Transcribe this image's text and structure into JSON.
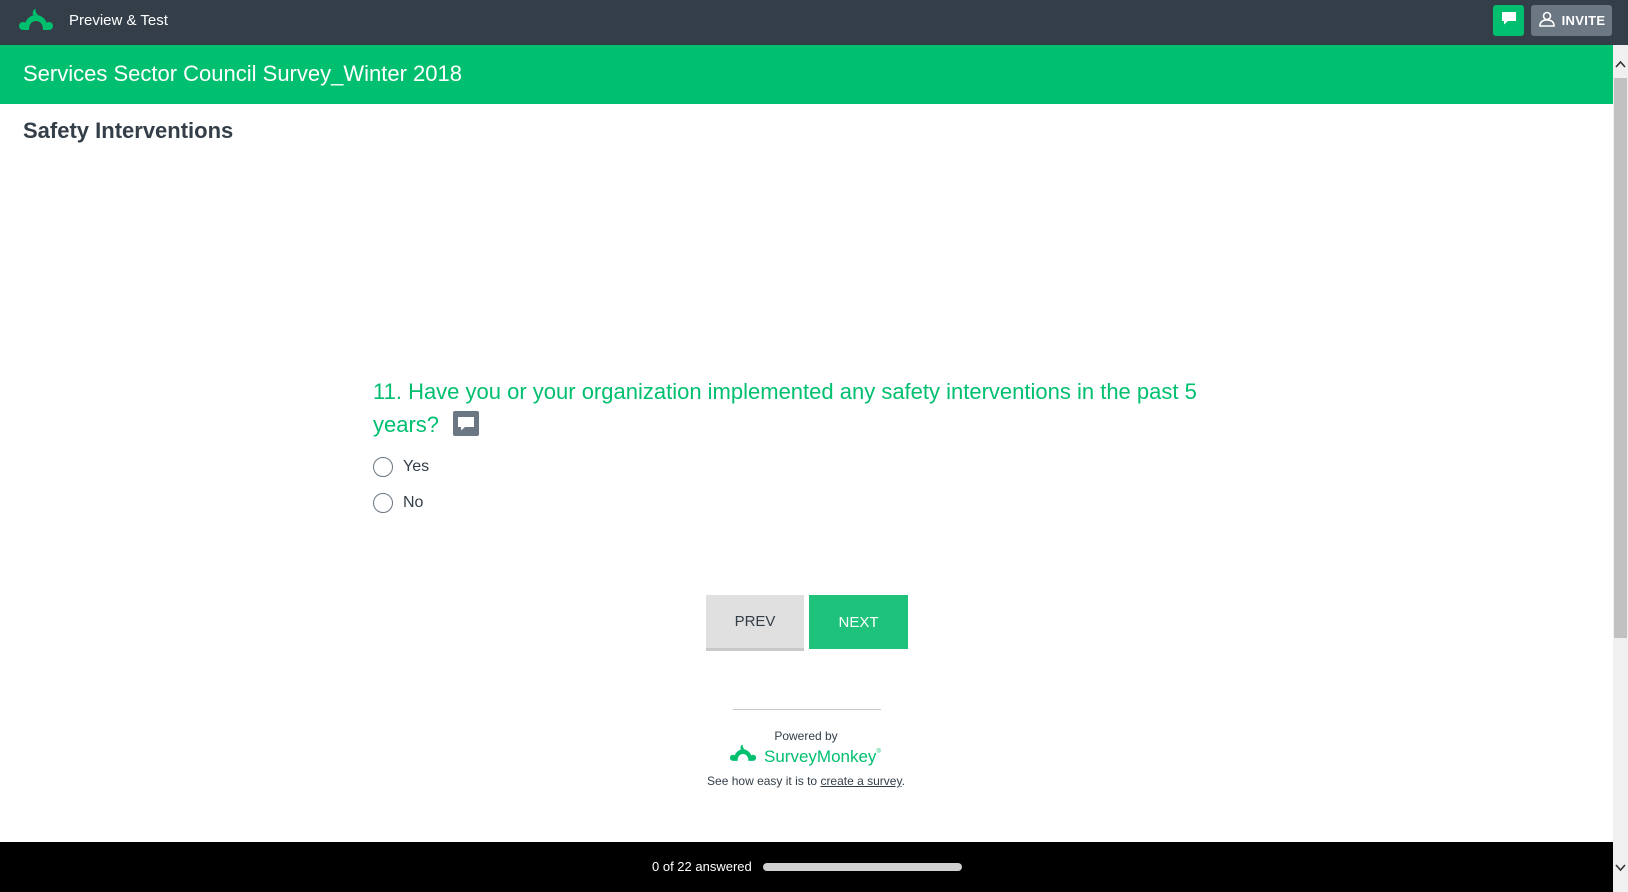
{
  "topbar": {
    "logo_icon": "surveymonkey-logo-icon",
    "app_title": "Preview & Test",
    "comment_icon": "speech-bubble-icon",
    "invite_icon": "person-icon",
    "invite_label": "INVITE"
  },
  "survey": {
    "title": "Services Sector Council Survey_Winter 2018",
    "page_title": "Safety Interventions"
  },
  "question": {
    "text": "11. Have you or your organization implemented any safety interventions in the past 5 years?",
    "comment_icon": "speech-bubble-icon",
    "choices": [
      {
        "label": "Yes",
        "selected": false
      },
      {
        "label": "No",
        "selected": false
      }
    ]
  },
  "nav": {
    "prev_label": "PREV",
    "next_label": "NEXT"
  },
  "branding": {
    "powered_by": "Powered by",
    "brand_name": "SurveyMonkey",
    "brand_mark": "®",
    "tagline_prefix": "See how easy it is to ",
    "tagline_link": "create a survey",
    "tagline_suffix": "."
  },
  "progress": {
    "text": "0 of 22 answered",
    "answered": 0,
    "total": 22,
    "fraction": 0.0
  },
  "colors": {
    "topbar_bg": "#333e48",
    "brand_green": "#00bf6f",
    "next_button": "#1fc27b",
    "footer_bg": "#000000"
  }
}
